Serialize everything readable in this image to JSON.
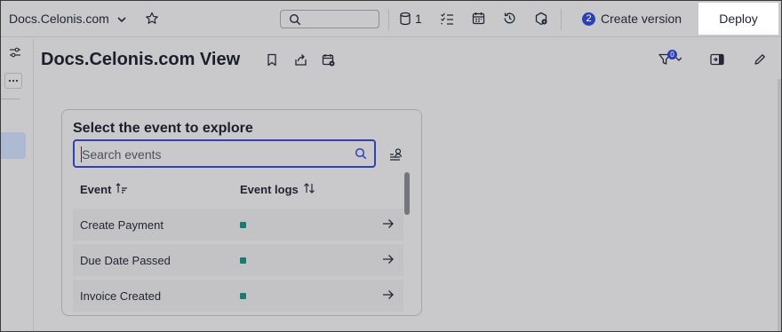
{
  "workspace": {
    "title": "Docs.Celonis.com"
  },
  "toolbar": {
    "search_placeholder": "",
    "knowledge_count": "1",
    "version_badge": "2",
    "create_version_label": "Create version",
    "deploy_label": "Deploy"
  },
  "view": {
    "title": "Docs.Celonis.com View",
    "filter_count": "0"
  },
  "explorer": {
    "title": "Select the event to explore",
    "search_placeholder": "Search events",
    "columns": {
      "event": "Event",
      "event_logs": "Event logs"
    },
    "rows": [
      {
        "event": "Create Payment",
        "log_color": "#1b7a74"
      },
      {
        "event": "Due Date Passed",
        "log_color": "#1b7a74"
      },
      {
        "event": "Invoice Created",
        "log_color": "#1b7a74"
      }
    ]
  },
  "icons": [
    "chevron-down-icon",
    "star-icon",
    "search-icon",
    "database-icon",
    "checklist-icon",
    "calendar-icon",
    "history-icon",
    "settings-package-icon",
    "sliders-icon",
    "more-icon",
    "bookmark-icon",
    "share-icon",
    "calendar-settings-icon",
    "filter-icon",
    "panel-toggle-icon",
    "edit-icon",
    "person-filter-icon",
    "sort-asc-icon",
    "sort-icon",
    "arrow-right-icon"
  ],
  "colors": {
    "accent": "#2c3fb3",
    "log_marker": "#1b7a74",
    "overlay_bg": "#c9c9cb"
  }
}
